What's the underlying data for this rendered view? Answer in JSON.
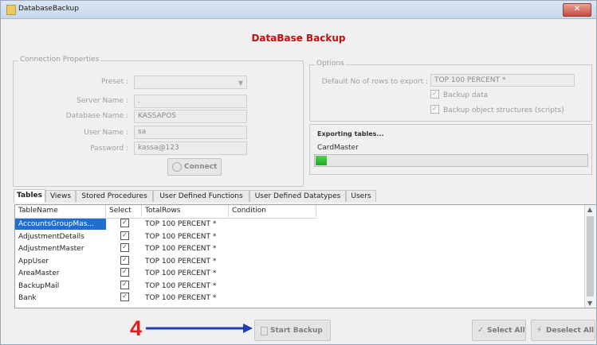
{
  "window": {
    "title": "DatabaseBackup",
    "close_glyph": "✕"
  },
  "heading": "DataBase Backup",
  "connection": {
    "legend": "Connection Properties",
    "preset_label": "Preset :",
    "preset_value": "",
    "server_label": "Server Name :",
    "server_value": ".",
    "database_label": "Database Name :",
    "database_value": "KASSAPOS",
    "user_label": "User Name :",
    "user_value": "sa",
    "password_label": "Password :",
    "password_value": "kassa@123",
    "connect_label": "Connect"
  },
  "options": {
    "legend": "Options",
    "rows_label": "Default No of rows to export :",
    "rows_value": "TOP 100 PERCENT *",
    "backup_data_label": "Backup data",
    "backup_data_checked": true,
    "backup_structures_label": "Backup object structures (scripts)",
    "backup_structures_checked": true
  },
  "export": {
    "title": "Exporting tables...",
    "current_table": "CardMaster",
    "progress_fraction": 0.04
  },
  "tabs": [
    {
      "label": "Tables",
      "active": true
    },
    {
      "label": "Views",
      "active": false
    },
    {
      "label": "Stored Procedures",
      "active": false
    },
    {
      "label": "User Defined Functions",
      "active": false
    },
    {
      "label": "User Defined Datatypes",
      "active": false
    },
    {
      "label": "Users",
      "active": false
    }
  ],
  "grid": {
    "columns": [
      "TableName",
      "Select",
      "TotalRows",
      "Condition"
    ],
    "rows": [
      {
        "name": "AccountsGroupMas...",
        "select": true,
        "total": "TOP 100 PERCENT *",
        "condition": "",
        "selected": true
      },
      {
        "name": "AdjustmentDetails",
        "select": true,
        "total": "TOP 100 PERCENT *",
        "condition": "",
        "selected": false
      },
      {
        "name": "AdjustmentMaster",
        "select": true,
        "total": "TOP 100 PERCENT *",
        "condition": "",
        "selected": false
      },
      {
        "name": "AppUser",
        "select": true,
        "total": "TOP 100 PERCENT *",
        "condition": "",
        "selected": false
      },
      {
        "name": "AreaMaster",
        "select": true,
        "total": "TOP 100 PERCENT *",
        "condition": "",
        "selected": false
      },
      {
        "name": "BackupMail",
        "select": true,
        "total": "TOP 100 PERCENT *",
        "condition": "",
        "selected": false
      },
      {
        "name": "Bank",
        "select": true,
        "total": "TOP 100 PERCENT *",
        "condition": "",
        "selected": false
      }
    ]
  },
  "buttons": {
    "start_backup": "Start Backup",
    "select_all": "Select All",
    "deselect_all": "Deselect All"
  },
  "annotation": {
    "number": "4",
    "color": "#e21b1b",
    "arrow_color": "#1f3fb0"
  },
  "colors": {
    "heading": "#c01010",
    "selection": "#1f6fd1",
    "progress": "#23a823"
  }
}
